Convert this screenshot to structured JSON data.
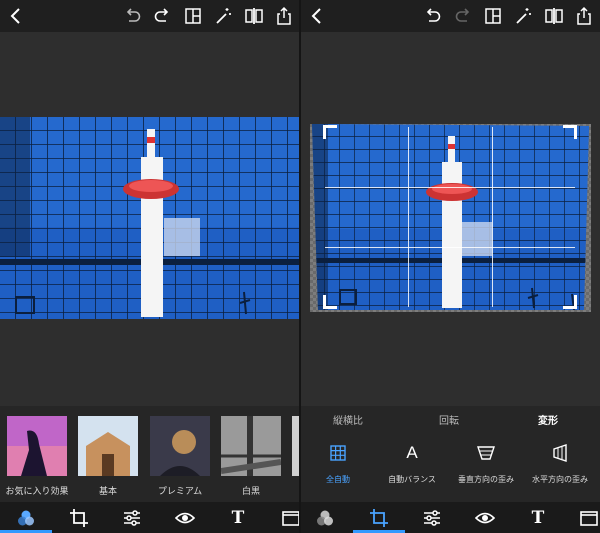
{
  "left": {
    "filters": [
      {
        "label": "お気に入り効果"
      },
      {
        "label": "基本"
      },
      {
        "label": "プレミアム"
      },
      {
        "label": "白黒"
      },
      {
        "label": ""
      }
    ]
  },
  "right": {
    "subtabs": [
      {
        "label": "縦横比"
      },
      {
        "label": "回転"
      },
      {
        "label": "変形"
      }
    ],
    "transform_options": [
      {
        "label": "全自動",
        "icon": "grid-icon"
      },
      {
        "label": "自動バランス",
        "icon": "letter-a-icon"
      },
      {
        "label": "垂直方向の歪み",
        "icon": "vertical-distortion-icon"
      },
      {
        "label": "水平方向の歪み",
        "icon": "horizontal-distortion-icon"
      }
    ],
    "active_subtab": "変形",
    "active_option": "全自動"
  },
  "toolbar_icons": [
    "back-icon",
    "undo-icon",
    "redo-icon",
    "layout-icon",
    "magic-wand-icon",
    "compare-icon",
    "share-icon"
  ],
  "bottom_icons": [
    "filters-icon",
    "crop-icon",
    "adjust-icon",
    "eye-icon",
    "text-icon",
    "frame-icon"
  ],
  "bottom_text_glyph": "T",
  "auto_balance_glyph": "A",
  "colors": {
    "accent": "#3399ff",
    "sky": "#1f5fc4",
    "panel": "#2e2e2e"
  }
}
